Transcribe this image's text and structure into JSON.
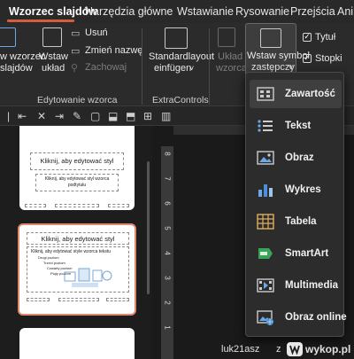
{
  "tabs": {
    "active": "Wzorzec slajdów",
    "items": [
      "Narzędzia główne",
      "Wstawianie",
      "Rysowanie",
      "Przejścia",
      "Anim"
    ]
  },
  "ribbon": {
    "btn_insert_master": [
      "w wzorzec",
      "slajdów"
    ],
    "btn_insert_layout": [
      "Wstaw",
      "układ"
    ],
    "btn_delete": "Usuń",
    "btn_rename": "Zmień nazwę",
    "btn_preserve": "Zachowaj",
    "group_edit_master": "Edytowanie wzorca",
    "btn_standard_layout": [
      "Standardlayout",
      "einfügen"
    ],
    "group_extra": "ExtraControls",
    "btn_master_layout": [
      "Układ",
      "wzorca"
    ],
    "btn_insert_placeholder": [
      "Wstaw symbol",
      "zastępczy"
    ],
    "chk_title": "Tytuł",
    "chk_footers": "Stopki"
  },
  "thumbnails": {
    "slide1": {
      "title": "Kliknij, aby edytować styl",
      "subtitle": [
        "Kliknij, aby edytować styl wzorca",
        "podtytułu"
      ]
    },
    "slide2": {
      "title": "Kliknij, aby edytować styl",
      "bullet": "Kliknij, aby edytować style wzorca tekstu",
      "level2": "Drugi poziom",
      "level3": "Trzeci poziom",
      "level4": "Czwarty poziom",
      "level5": "Piąty poziom"
    }
  },
  "ruler": {
    "numbers": [
      "8",
      "7",
      "6",
      "5",
      "4",
      "3",
      "2",
      "1"
    ]
  },
  "placeholder_menu": {
    "items": [
      {
        "label": "Zawartość",
        "icon": "content-icon"
      },
      {
        "label": "Tekst",
        "icon": "text-icon"
      },
      {
        "label": "Obraz",
        "icon": "picture-icon"
      },
      {
        "label": "Wykres",
        "icon": "chart-icon"
      },
      {
        "label": "Tabela",
        "icon": "table-icon"
      },
      {
        "label": "SmartArt",
        "icon": "smartart-icon"
      },
      {
        "label": "Multimedia",
        "icon": "media-icon"
      },
      {
        "label": "Obraz online",
        "icon": "online-picture-icon"
      }
    ]
  },
  "watermark": {
    "user": "luk21asz",
    "site": "wykop.pl"
  }
}
